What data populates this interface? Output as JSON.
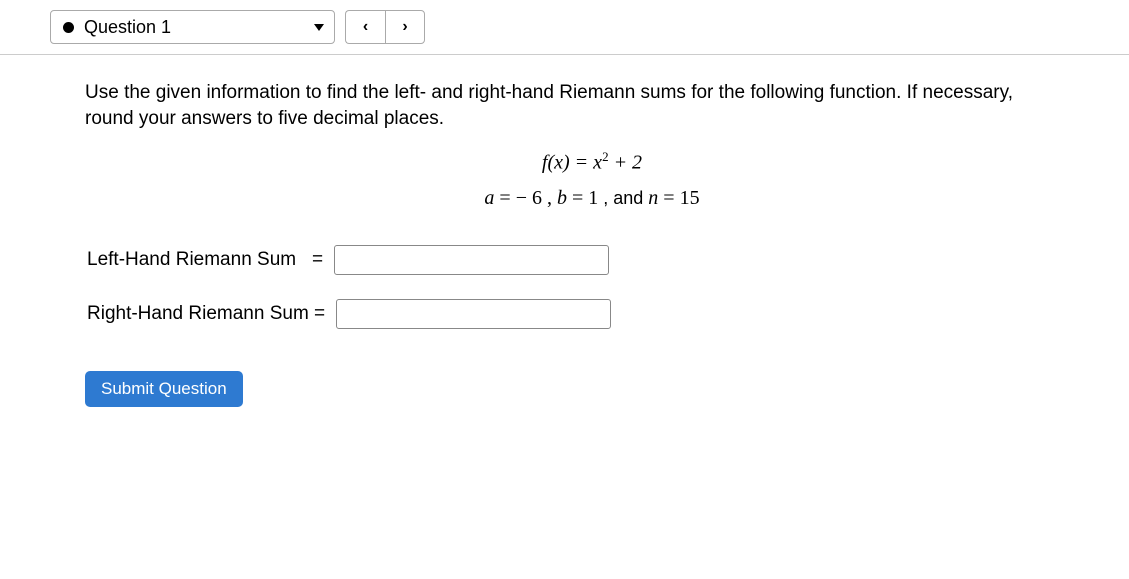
{
  "toolbar": {
    "question_label": "Question 1",
    "prev_glyph": "‹",
    "next_glyph": "›"
  },
  "question": {
    "instructions": "Use the given information to find the left- and right-hand Riemann sums for the following function. If necessary, round your answers to five decimal places.",
    "fx_prefix": "f(x) = x",
    "fx_exponent": "2",
    "fx_suffix": " + 2",
    "params": {
      "a_lbl": "a",
      "a_val": " − 6",
      "b_lbl": "b",
      "b_val": "1",
      "n_lbl": "n",
      "n_val": "15",
      "and": ", and "
    },
    "left_label": "Left-Hand Riemann Sum   = ",
    "right_label": "Right-Hand Riemann Sum = ",
    "left_value": "",
    "right_value": "",
    "submit_label": "Submit Question"
  }
}
